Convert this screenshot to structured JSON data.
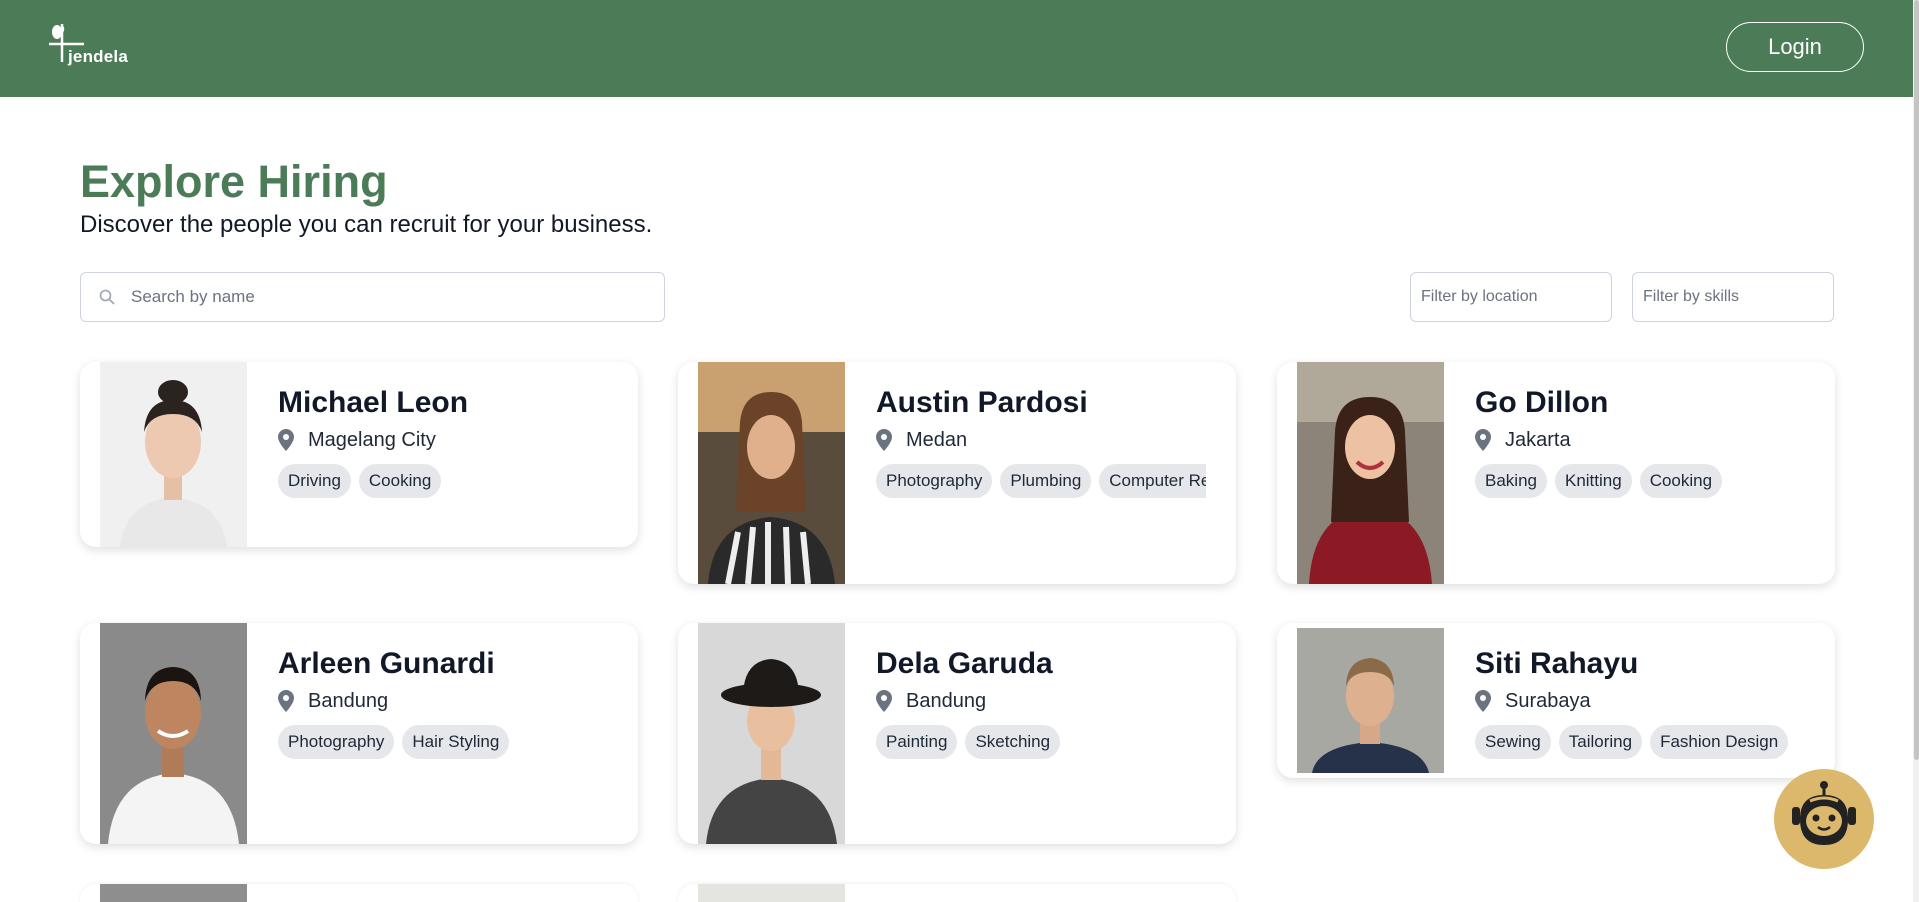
{
  "header": {
    "logo_text": "jendela",
    "login_label": "Login"
  },
  "page": {
    "title": "Explore Hiring",
    "subtitle": "Discover the people you can recruit for your business."
  },
  "search": {
    "placeholder": "Search by name"
  },
  "filters": {
    "location_placeholder": "Filter by location",
    "skills_placeholder": "Filter by skills"
  },
  "icons": {
    "search": "search-icon",
    "location": "map-pin-icon",
    "chatbot": "robot-icon"
  },
  "colors": {
    "brand": "#4b7c57",
    "chip_bg": "#e5e7eb",
    "chatbot_bg": "#dcb86c"
  },
  "cards": [
    {
      "name": "Michael Leon",
      "location": "Magelang City",
      "skills": [
        "Driving",
        "Cooking"
      ]
    },
    {
      "name": "Austin Pardosi",
      "location": "Medan",
      "skills": [
        "Photography",
        "Plumbing",
        "Computer Repair"
      ]
    },
    {
      "name": "Go Dillon",
      "location": "Jakarta",
      "skills": [
        "Baking",
        "Knitting",
        "Cooking"
      ]
    },
    {
      "name": "Arleen Gunardi",
      "location": "Bandung",
      "skills": [
        "Photography",
        "Hair Styling"
      ]
    },
    {
      "name": "Dela Garuda",
      "location": "Bandung",
      "skills": [
        "Painting",
        "Sketching"
      ]
    },
    {
      "name": "Siti Rahayu",
      "location": "Surabaya",
      "skills": [
        "Sewing",
        "Tailoring",
        "Fashion Design"
      ]
    }
  ]
}
